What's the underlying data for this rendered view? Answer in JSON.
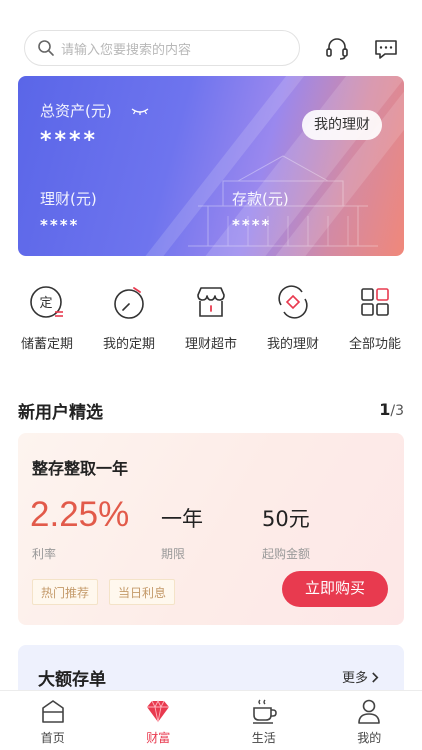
{
  "search": {
    "placeholder": "请输入您要搜索的内容"
  },
  "top_icons": [
    "headset-icon",
    "message-icon"
  ],
  "assets": {
    "total_label": "总资产(元)",
    "total_value": "****",
    "finance_label": "理财(元)",
    "finance_value": "****",
    "deposit_label": "存款(元)",
    "deposit_value": "****",
    "my_finance_button": "我的理财"
  },
  "quick_functions": [
    {
      "label": "储蓄定期",
      "icon": "fixed-deposit-icon"
    },
    {
      "label": "我的定期",
      "icon": "timer-icon"
    },
    {
      "label": "理财超市",
      "icon": "store-icon"
    },
    {
      "label": "我的理财",
      "icon": "diamond-refresh-icon"
    },
    {
      "label": "全部功能",
      "icon": "grid-icon"
    }
  ],
  "section": {
    "title": "新用户精选",
    "page_current": "1",
    "page_total": "/3"
  },
  "product": {
    "name": "整存整取一年",
    "rate": "2.25%",
    "rate_label": "利率",
    "term": "一年",
    "term_label": "期限",
    "min_amount": "50元",
    "min_amount_label": "起购金额",
    "tags": [
      "热门推荐",
      "当日利息"
    ],
    "buy_button": "立即购买"
  },
  "deposit_card": {
    "title": "大额存单",
    "more": "更多"
  },
  "bottom_nav": [
    {
      "label": "首页",
      "icon": "home-icon",
      "active": false
    },
    {
      "label": "财富",
      "icon": "gem-icon",
      "active": true
    },
    {
      "label": "生活",
      "icon": "coffee-icon",
      "active": false
    },
    {
      "label": "我的",
      "icon": "user-icon",
      "active": false
    }
  ],
  "colors": {
    "accent": "#e83a4f",
    "card_start": "#5a66e8",
    "card_end": "#f0887a",
    "rate": "#e25a4a"
  }
}
